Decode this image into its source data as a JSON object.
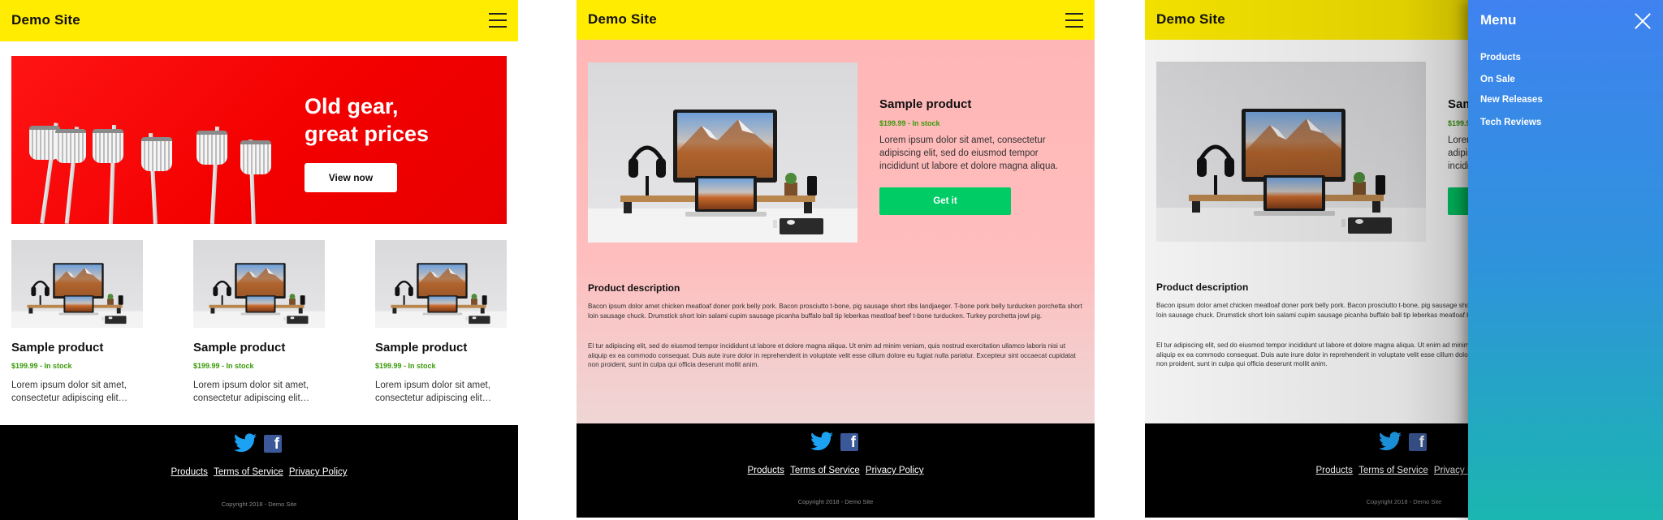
{
  "site": {
    "name": "Demo Site"
  },
  "hero": {
    "title_line1": "Old gear,",
    "title_line2": "great prices",
    "button": "View now"
  },
  "products": [
    {
      "name": "Sample product",
      "price": "$199.99 - In stock",
      "desc": "Lorem ipsum dolor sit amet, consectetur adipiscing elit…"
    },
    {
      "name": "Sample product",
      "price": "$199.99 - In stock",
      "desc": "Lorem ipsum dolor sit amet, consectetur adipiscing elit…"
    },
    {
      "name": "Sample product",
      "price": "$199.99 - In stock",
      "desc": "Lorem ipsum dolor sit amet, consectetur adipiscing elit…"
    }
  ],
  "detail": {
    "name": "Sample product",
    "price": "$199.99 - In stock",
    "desc": "Lorem ipsum dolor sit amet, consectetur adipiscing elit, sed do eiusmod tempor incididunt ut labore et dolore magna aliqua.",
    "button": "Get it",
    "section_title": "Product description",
    "para1": "Bacon ipsum dolor amet chicken meatloaf doner pork belly pork. Bacon prosciutto t-bone, pig sausage short ribs landjaeger. T-bone pork belly turducken porchetta short loin sausage chuck. Drumstick short loin salami cupim sausage picanha buffalo ball tip leberkas meatloaf beef t-bone turducken. Turkey porchetta jowl pig.",
    "para2": "El tur adipiscing elit, sed do eiusmod tempor incididunt ut labore et dolore magna aliqua. Ut enim ad minim veniam, quis nostrud exercitation ullamco laboris nisi ut aliquip ex ea commodo consequat. Duis aute irure dolor in reprehenderit in voluptate velit esse cillum dolore eu fugiat nulla pariatur. Excepteur sint occaecat cupidatat non proident, sunt in culpa qui officia deserunt mollit anim."
  },
  "footer": {
    "links": [
      "Products",
      "Terms of Service",
      "Privacy Policy"
    ],
    "copyright": "Copyright 2018 - Demo Site",
    "social": [
      "twitter-icon",
      "facebook-icon"
    ]
  },
  "menu": {
    "title": "Menu",
    "items": [
      "Products",
      "On Sale",
      "New Releases",
      "Tech Reviews"
    ]
  },
  "colors": {
    "header": "#ffec00",
    "hero": "#ff0000",
    "price": "#3a9a0a",
    "get_button": "#00cc66",
    "menu_top": "#3f82f0",
    "menu_bottom": "#1bb6b0",
    "product_bg": "#ffb6b6"
  }
}
